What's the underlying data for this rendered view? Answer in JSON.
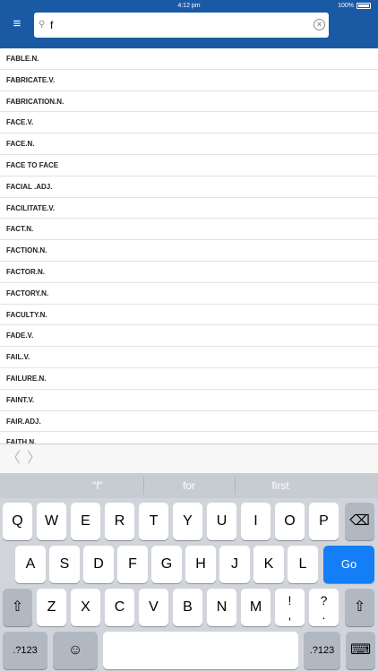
{
  "status_bar": {
    "time": "4:12 pm",
    "battery": "100%"
  },
  "header": {
    "menu_icon": "hamburger-icon",
    "search": {
      "value": "f",
      "placeholder": ""
    }
  },
  "words": [
    "FABLE.N.",
    "FABRICATE.V.",
    "FABRICATION.N.",
    "FACE.V.",
    "FACE.N.",
    "FACE TO FACE",
    "FACIAL .ADJ.",
    "FACILITATE.V.",
    "FACT.N.",
    "FACTION.N.",
    "FACTOR.N.",
    "FACTORY.N.",
    "FACULTY.N.",
    "FADE.V.",
    "FAIL.V.",
    "FAILURE.N.",
    "FAINT.V.",
    "FAIR.ADJ.",
    "FAITH.N."
  ],
  "nav": {
    "back_glyph": "〈",
    "forward_glyph": "〉"
  },
  "keyboard": {
    "suggestions": [
      "\"f\"",
      "for",
      "first"
    ],
    "row1": [
      "Q",
      "W",
      "E",
      "R",
      "T",
      "Y",
      "U",
      "I",
      "O",
      "P"
    ],
    "row2": [
      "A",
      "S",
      "D",
      "F",
      "G",
      "H",
      "J",
      "K",
      "L"
    ],
    "row3": [
      "Z",
      "X",
      "C",
      "V",
      "B",
      "N",
      "M"
    ],
    "punct1": "!\n,",
    "punct2": "?\n.",
    "go_label": "Go",
    "numbers_label": ".?123",
    "backspace_glyph": "⌫",
    "shift_glyph": "⇧",
    "emoji_glyph": "☺",
    "hide_glyph": "⌨",
    "accent": "#137ef5"
  }
}
